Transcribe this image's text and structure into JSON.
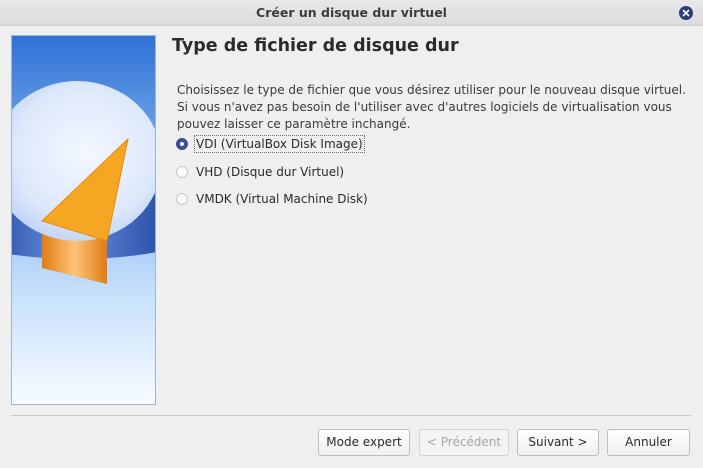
{
  "window": {
    "title": "Créer un disque dur virtuel"
  },
  "page": {
    "heading": "Type de fichier de disque dur",
    "description": "Choisissez le type de fichier que vous désirez utiliser pour le nouveau disque virtuel. Si vous n'avez pas besoin de l'utiliser avec d'autres logiciels de virtualisation vous pouvez laisser ce paramètre inchangé."
  },
  "options": [
    {
      "label": "VDI (VirtualBox Disk Image)",
      "selected": true
    },
    {
      "label": "VHD (Disque dur Virtuel)",
      "selected": false
    },
    {
      "label": "VMDK (Virtual Machine Disk)",
      "selected": false
    }
  ],
  "buttons": {
    "expert": "Mode expert",
    "previous": "< Précédent",
    "next": "Suivant >",
    "cancel": "Annuler"
  },
  "colors": {
    "accent": "#3d4f96",
    "pie_orange": "#f5a623",
    "pie_blue": "#3a6fd1"
  },
  "icons": {
    "close": "close-icon",
    "side": "disk-pie-illustration"
  }
}
